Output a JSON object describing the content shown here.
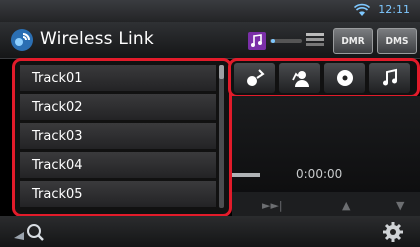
{
  "status": {
    "time": "12:11"
  },
  "header": {
    "title": "Wireless Link",
    "dmr_label": "DMR",
    "dms_label": "DMS"
  },
  "tracks": [
    "Track01",
    "Track02",
    "Track03",
    "Track04",
    "Track05"
  ],
  "source_buttons": [
    "guitar-icon",
    "artist-icon",
    "disc-icon",
    "music-note-icon"
  ],
  "player": {
    "elapsed": "0:00:00"
  },
  "colors": {
    "highlight": "#e21b2a",
    "accent": "#7ec8ff",
    "music": "#b04ad6"
  }
}
